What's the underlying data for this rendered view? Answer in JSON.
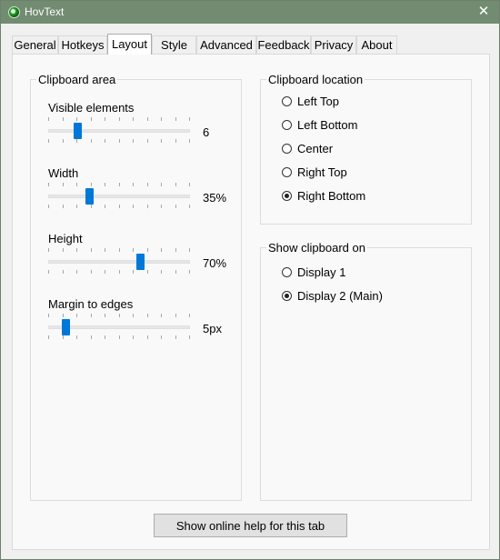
{
  "window": {
    "title": "HovText",
    "close_glyph": "✕",
    "accent": "#728c72"
  },
  "tabs": [
    {
      "label": "General",
      "active": false
    },
    {
      "label": "Hotkeys",
      "active": false
    },
    {
      "label": "Layout",
      "active": true
    },
    {
      "label": "Style",
      "active": false
    },
    {
      "label": "Advanced",
      "active": false
    },
    {
      "label": "Feedback",
      "active": false
    },
    {
      "label": "Privacy",
      "active": false
    },
    {
      "label": "About",
      "active": false
    }
  ],
  "clipboard_area": {
    "title": "Clipboard area",
    "sliders": [
      {
        "label": "Visible elements",
        "value": "6",
        "fraction": 0.19
      },
      {
        "label": "Width",
        "value": "35%",
        "fraction": 0.28
      },
      {
        "label": "Height",
        "value": "70%",
        "fraction": 0.66
      },
      {
        "label": "Margin to edges",
        "value": "5px",
        "fraction": 0.1
      }
    ]
  },
  "clipboard_location": {
    "title": "Clipboard location",
    "options": [
      {
        "label": "Left Top",
        "checked": false
      },
      {
        "label": "Left Bottom",
        "checked": false
      },
      {
        "label": "Center",
        "checked": false
      },
      {
        "label": "Right Top",
        "checked": false
      },
      {
        "label": "Right Bottom",
        "checked": true
      }
    ]
  },
  "show_clipboard_on": {
    "title": "Show clipboard on",
    "options": [
      {
        "label": "Display 1",
        "checked": false
      },
      {
        "label": "Display 2 (Main)",
        "checked": true
      }
    ]
  },
  "help_button": {
    "label": "Show online help for this tab"
  },
  "colors": {
    "slider_thumb": "#0078d7"
  }
}
